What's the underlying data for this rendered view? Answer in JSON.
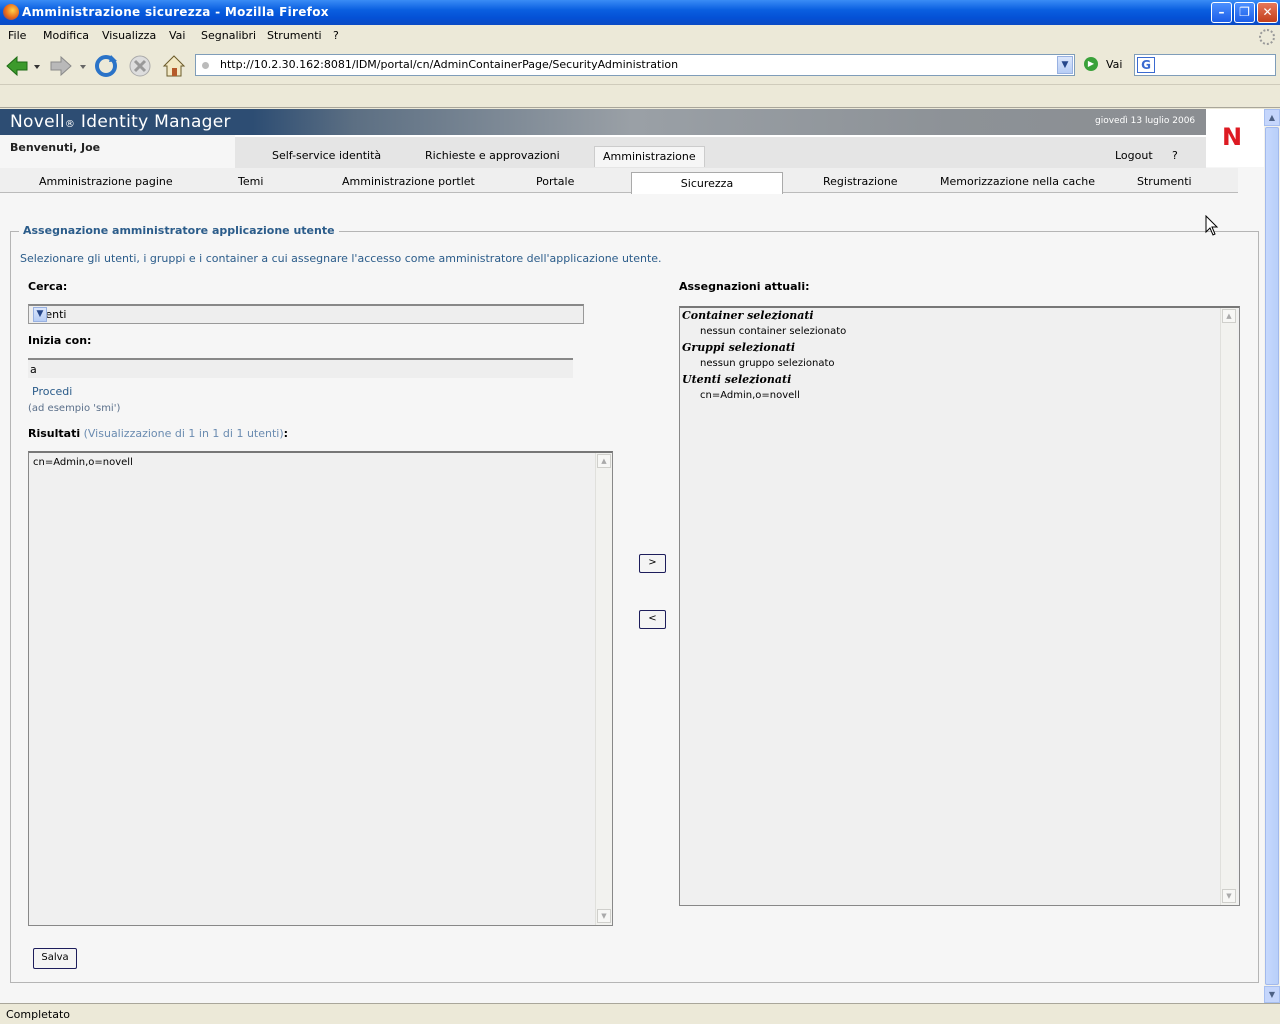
{
  "window": {
    "title": "Amministrazione sicurezza - Mozilla Firefox"
  },
  "menu": {
    "items": [
      {
        "label": "File"
      },
      {
        "label": "Modifica"
      },
      {
        "label": "Visualizza"
      },
      {
        "label": "Vai"
      },
      {
        "label": "Segnalibri"
      },
      {
        "label": "Strumenti"
      },
      {
        "label": "?"
      }
    ]
  },
  "nav": {
    "url": "http://10.2.30.162:8081/IDM/portal/cn/AdminContainerPage/SecurityAdministration",
    "go_label": "Vai"
  },
  "status": {
    "text": "Completato"
  },
  "header": {
    "brand": "Novell",
    "brand_mark": "®",
    "product": "Identity Manager",
    "date": "giovedì 13 luglio 2006",
    "logo_letter": "N",
    "welcome": "Benvenuti, Joe"
  },
  "top_tabs": [
    {
      "label": "Self-service identità"
    },
    {
      "label": "Richieste e approvazioni"
    },
    {
      "label": "Amministrazione"
    }
  ],
  "top_links": {
    "logout": "Logout",
    "help": "?"
  },
  "sub_tabs": [
    {
      "label": "Amministrazione pagine"
    },
    {
      "label": "Temi"
    },
    {
      "label": "Amministrazione portlet"
    },
    {
      "label": "Portale"
    },
    {
      "label": "Sicurezza"
    },
    {
      "label": "Registrazione"
    },
    {
      "label": "Memorizzazione nella cache"
    },
    {
      "label": "Strumenti"
    }
  ],
  "panel": {
    "legend": "Assegnazione amministratore applicazione utente",
    "intro": "Selezionare gli utenti, i gruppi e i container a cui assegnare l'accesso come amministratore dell'applicazione utente.",
    "search_label": "Cerca:",
    "search_value": "Utenti",
    "starts_label": "Inizia con:",
    "starts_value": "a",
    "procedi": "Procedi",
    "hint": "(ad esempio 'smi')",
    "results_label": "Risultati",
    "results_count": "(Visualizzazione di 1 in 1 di 1 utenti)",
    "results_colon": ":",
    "results": [
      "cn=Admin,o=novell"
    ],
    "move_right": ">",
    "move_left": "<",
    "assign_label": "Assegnazioni attuali:",
    "assign": {
      "containers_head": "Container selezionati",
      "containers_value": "nessun container selezionato",
      "groups_head": "Gruppi selezionati",
      "groups_value": "nessun gruppo selezionato",
      "users_head": "Utenti selezionati",
      "users_value": "cn=Admin,o=novell"
    },
    "save": "Salva"
  }
}
